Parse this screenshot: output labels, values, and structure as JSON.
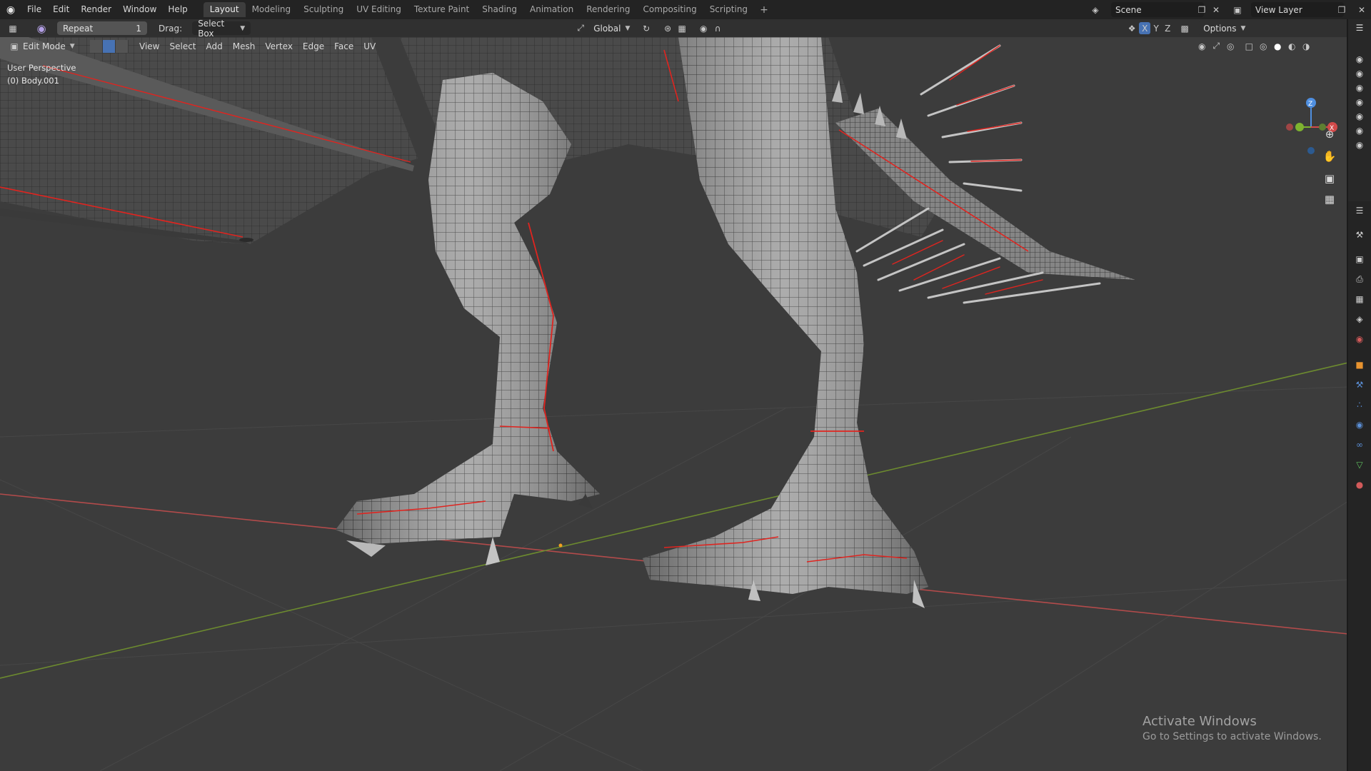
{
  "topbar": {
    "menus": [
      "File",
      "Edit",
      "Render",
      "Window",
      "Help"
    ],
    "workspaces": [
      "Layout",
      "Modeling",
      "Sculpting",
      "UV Editing",
      "Texture Paint",
      "Shading",
      "Animation",
      "Rendering",
      "Compositing",
      "Scripting"
    ],
    "active_workspace": "Layout",
    "add_workspace": "+",
    "scene": "Scene",
    "view_layer": "View Layer"
  },
  "toolbar": {
    "repeat_label": "Repeat",
    "repeat_count": "1",
    "drag_label": "Drag:",
    "drag_value": "Select Box",
    "transform_orientation": "Global",
    "options_label": "Options",
    "axis_x": "X",
    "axis_y": "Y",
    "axis_z": "Z"
  },
  "viewport_header": {
    "mode": "Edit Mode",
    "menus": [
      "View",
      "Select",
      "Add",
      "Mesh",
      "Vertex",
      "Edge",
      "Face",
      "UV"
    ]
  },
  "viewport": {
    "perspective": "User Perspective",
    "object": "(0) Body.001",
    "gizmo_x": "X",
    "gizmo_z": "Z"
  },
  "watermark": {
    "title": "Activate Windows",
    "subtitle": "Go to Settings to activate Windows."
  },
  "colors": {
    "background": "#3c3c3c",
    "topbar": "#232323",
    "accent": "#4772b3",
    "seam": "#e0241f",
    "x_axis": "#b34b4b",
    "y_axis": "#6c8a2f"
  }
}
